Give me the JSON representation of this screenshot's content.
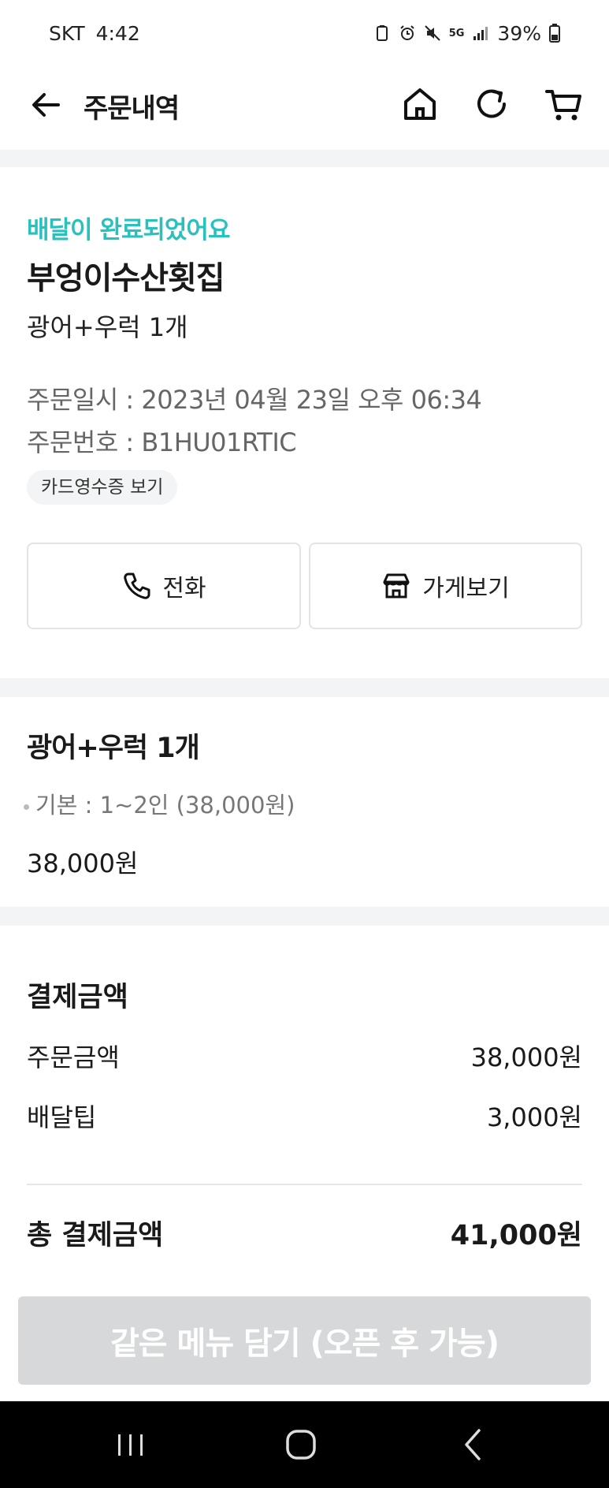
{
  "status_bar": {
    "carrier": "SKT",
    "time": "4:42",
    "network": "5G",
    "battery": "39%"
  },
  "header": {
    "title": "주문내역"
  },
  "order": {
    "status_message": "배달이 완료되었어요",
    "store_name": "부엉이수산횟집",
    "menu_summary": "광어+우럭 1개",
    "order_datetime": "주문일시 : 2023년 04월 23일 오후 06:34",
    "order_number": "주문번호 : B1HU01RTIC",
    "receipt_chip": "카드영수증 보기",
    "call_label": "전화",
    "store_label": "가게보기"
  },
  "item": {
    "title": "광어+우럭 1개",
    "option": "기본 : 1~2인 (38,000원)",
    "price": "38,000원"
  },
  "payment": {
    "title": "결제금액",
    "order_amount_label": "주문금액",
    "order_amount_value": "38,000원",
    "delivery_tip_label": "배달팁",
    "delivery_tip_value": "3,000원",
    "total_label": "총 결제금액",
    "total_value": "41,000원"
  },
  "cta": {
    "label": "같은 메뉴 담기 (오픈 후 가능)"
  },
  "colors": {
    "accent": "#2ac1bc",
    "disabled": "#d6d8da"
  }
}
